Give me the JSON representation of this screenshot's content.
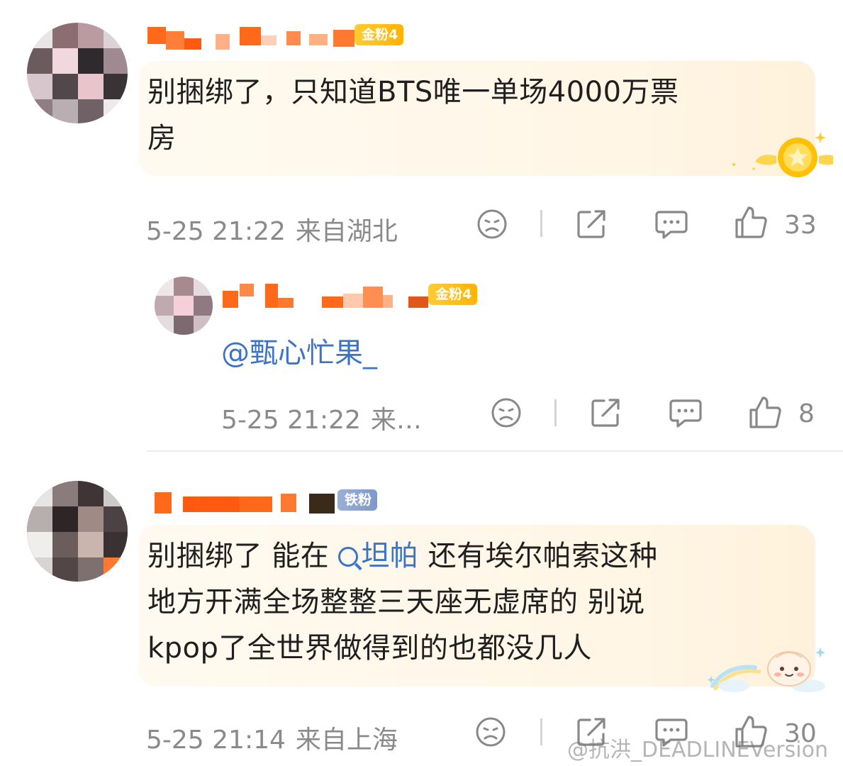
{
  "comments": [
    {
      "badge": "金粉4",
      "text_line1": "别捆绑了，只知道BTS唯一单场4000万票",
      "text_line2": "房",
      "time": "5-25 21:22",
      "location": "来自湖北",
      "likes": "33"
    },
    {
      "badge": "金粉4",
      "reply_text": "@甄心忙果_",
      "time": "5-25 21:22",
      "location": "来…",
      "likes": "8"
    },
    {
      "badge": "铁粉",
      "text_pre": "别捆绑了 能在 ",
      "topic": "坦帕",
      "text_post": " 还有埃尔帕索这种",
      "text_line2": "地方开满全场整整三天座无虚席的 别说",
      "text_line3": "kpop了全世界做得到的也都没几人",
      "time": "5-25 21:14",
      "location": "来自上海",
      "likes": "30"
    }
  ],
  "icons": {
    "dislike": "sad-face-icon",
    "share": "share-icon",
    "comment": "comment-icon",
    "like": "thumbs-up-icon",
    "fan_badge": "gold-medal-icon",
    "sticker": "bun-sticker-icon"
  },
  "watermark": "@抗洪_DEADLINEVersion",
  "colors": {
    "accent_orange": "#ff6a1a",
    "badge_gold": "#ffbb1f",
    "link_blue": "#3b73c7",
    "meta_gray": "#8a8a8a",
    "bubble_bg": "#fff6e6"
  }
}
